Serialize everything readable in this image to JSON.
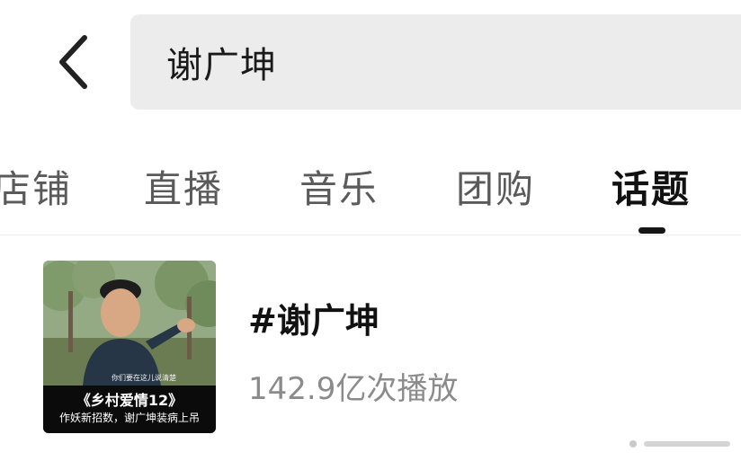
{
  "search": {
    "query": "谢广坤"
  },
  "tabs": [
    {
      "label": "店铺",
      "active": false
    },
    {
      "label": "直播",
      "active": false
    },
    {
      "label": "音乐",
      "active": false
    },
    {
      "label": "团购",
      "active": false
    },
    {
      "label": "话题",
      "active": true
    }
  ],
  "topic": {
    "name": "#谢广坤",
    "plays": "142.9亿次播放",
    "thumbnail": {
      "title": "《乡村爱情12》",
      "subtitle": "作妖新招数，谢广坤装病上吊",
      "caption": "你们要在这儿说清楚"
    }
  },
  "colors": {
    "search_bg": "#ececec",
    "active_tab": "#111111",
    "inactive_tab": "#5a5a5a",
    "secondary_text": "#8b8b8b",
    "divider": "#ededed"
  },
  "icons": {
    "back": "chevron-left-icon"
  }
}
